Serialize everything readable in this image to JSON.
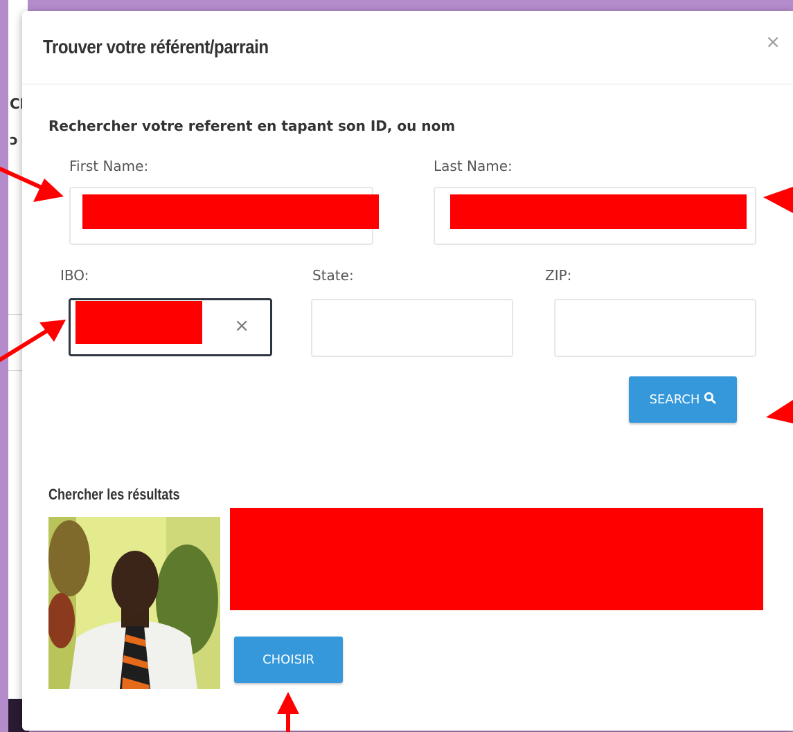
{
  "modal": {
    "title": "Trouver votre référent/parrain",
    "close_symbol": "×",
    "instruction": "Rechercher votre referent en tapant son ID, ou nom"
  },
  "form": {
    "first_name_label": "First Name:",
    "last_name_label": "Last Name:",
    "ibo_label": "IBO:",
    "state_label": "State:",
    "zip_label": "ZIP:",
    "state_value": "",
    "zip_value": "",
    "clear_symbol": "×",
    "search_label": "SEARCH"
  },
  "results": {
    "heading": "Chercher les résultats",
    "choose_label": "CHOISIR"
  },
  "background": {
    "fragment_top": "CH",
    "fragment_mid": "ɔ"
  },
  "colors": {
    "accent": "#3498db",
    "redaction": "#ff0000",
    "annotation_arrow": "#ff0000",
    "backdrop": "#b48ccc"
  },
  "icons": {
    "search": "search-icon",
    "close": "close-icon",
    "clear": "clear-icon"
  }
}
